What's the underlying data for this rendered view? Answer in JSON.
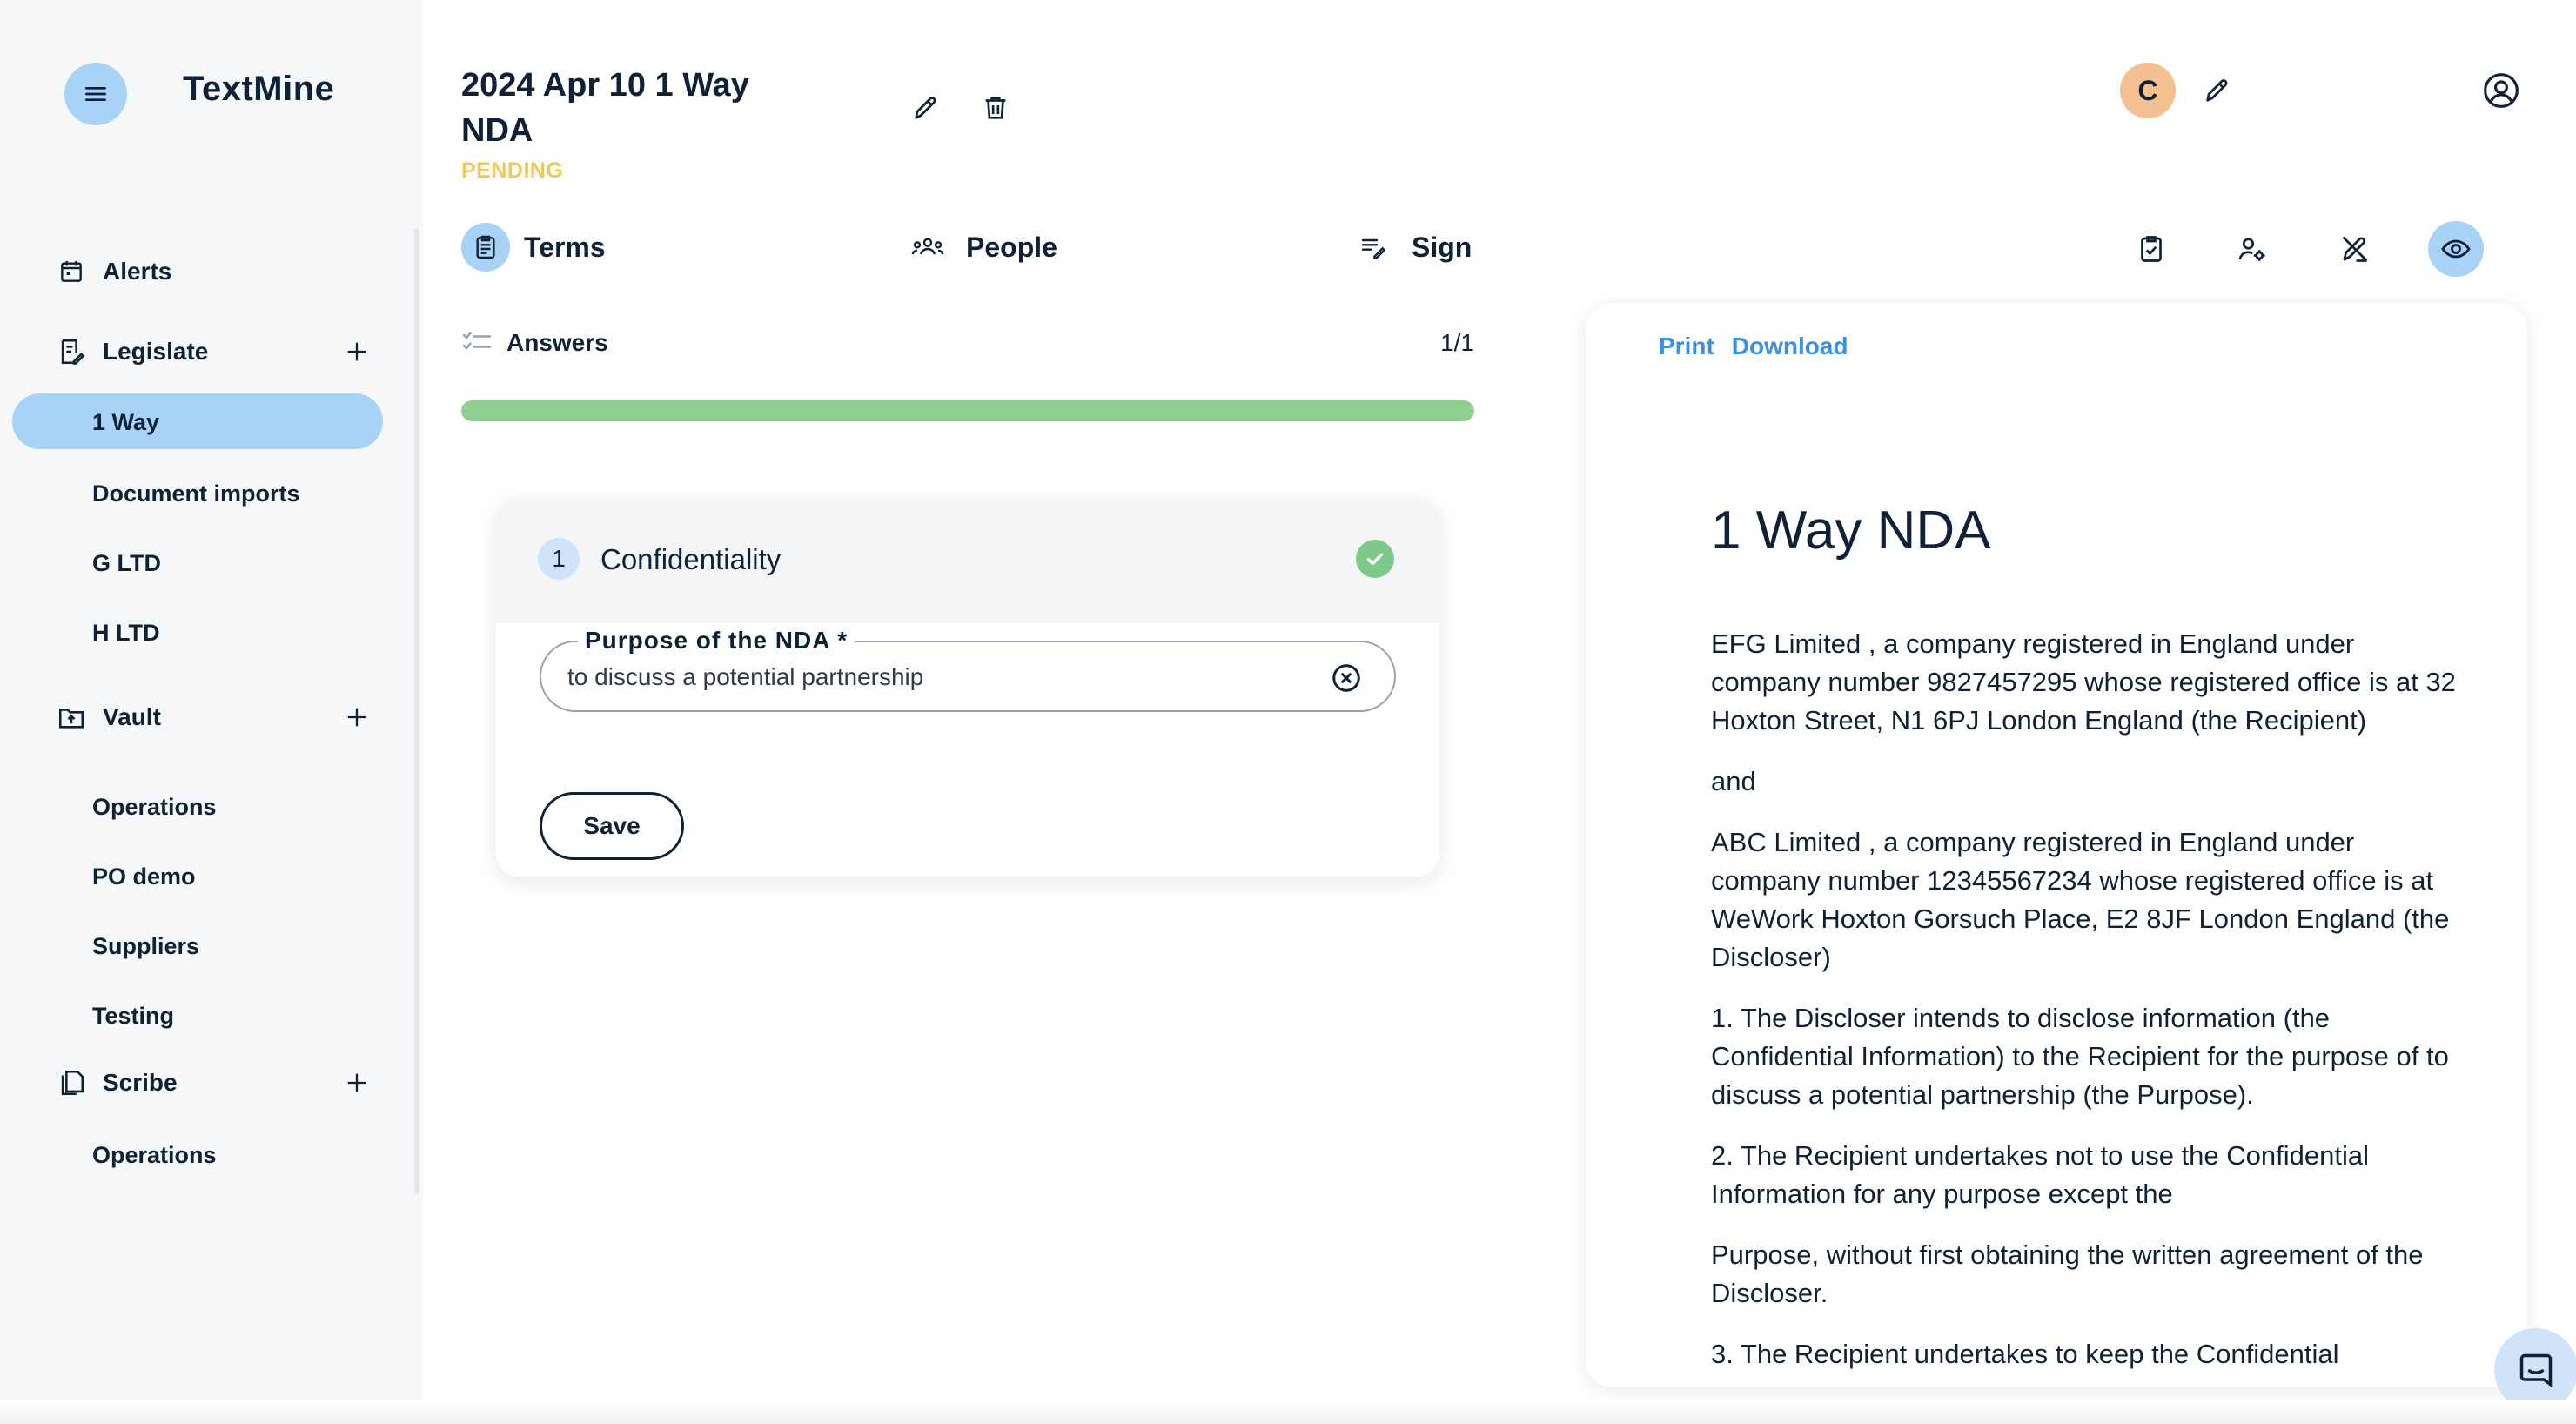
{
  "app": {
    "brand": "TextMine"
  },
  "sidebar": {
    "sections": [
      {
        "label": "Alerts",
        "icon": "calendar-icon"
      },
      {
        "label": "Legislate",
        "icon": "legislate-icon"
      },
      {
        "label": "Vault",
        "icon": "folder-upload-icon"
      },
      {
        "label": "Scribe",
        "icon": "copy-icon"
      }
    ],
    "legislate_items": [
      "1 Way",
      "Document imports",
      "G LTD",
      "H LTD"
    ],
    "vault_items": [
      "Operations",
      "PO demo",
      "Suppliers",
      "Testing"
    ],
    "scribe_items": [
      "Operations"
    ],
    "active_item": "1 Way"
  },
  "header": {
    "title": "2024 Apr 10 1 Way NDA",
    "status": "PENDING",
    "avatar_initial": "C"
  },
  "tabs": [
    {
      "label": "Terms",
      "icon": "clipboard-icon",
      "active": true
    },
    {
      "label": "People",
      "icon": "people-icon",
      "active": false
    },
    {
      "label": "Sign",
      "icon": "sign-list-icon",
      "active": false
    }
  ],
  "answers": {
    "label": "Answers",
    "count": "1/1",
    "progress_fraction": 1.0
  },
  "question": {
    "number": "1",
    "title": "Confidentiality",
    "field_label": "Purpose of the NDA *",
    "field_value": "to discuss a potential partnership",
    "save_label": "Save"
  },
  "preview": {
    "print_label": "Print",
    "download_label": "Download",
    "title": "1 Way NDA",
    "paragraphs": [
      "EFG Limited , a company registered in England under company number 9827457295 whose registered office is at 32 Hoxton Street, N1 6PJ London England (the Recipient)",
      "and",
      "ABC Limited , a company registered in England under company number 12345567234 whose registered office is at WeWork Hoxton Gorsuch Place, E2 8JF London England (the Discloser)",
      "1. The Discloser intends to disclose information (the Confidential Information) to the Recipient for the purpose of to discuss a potential partnership (the Purpose).",
      "2. The Recipient undertakes not to use the Confidential Information for any purpose except the",
      "Purpose, without first obtaining the written agreement of the Discloser.",
      "3. The Recipient undertakes to keep the Confidential"
    ]
  },
  "colors": {
    "accent": "#a9d2f7",
    "status_pending": "#f2c75c",
    "progress": "#8fcf8f",
    "link": "#3a8fe6",
    "text": "#0f2137"
  }
}
